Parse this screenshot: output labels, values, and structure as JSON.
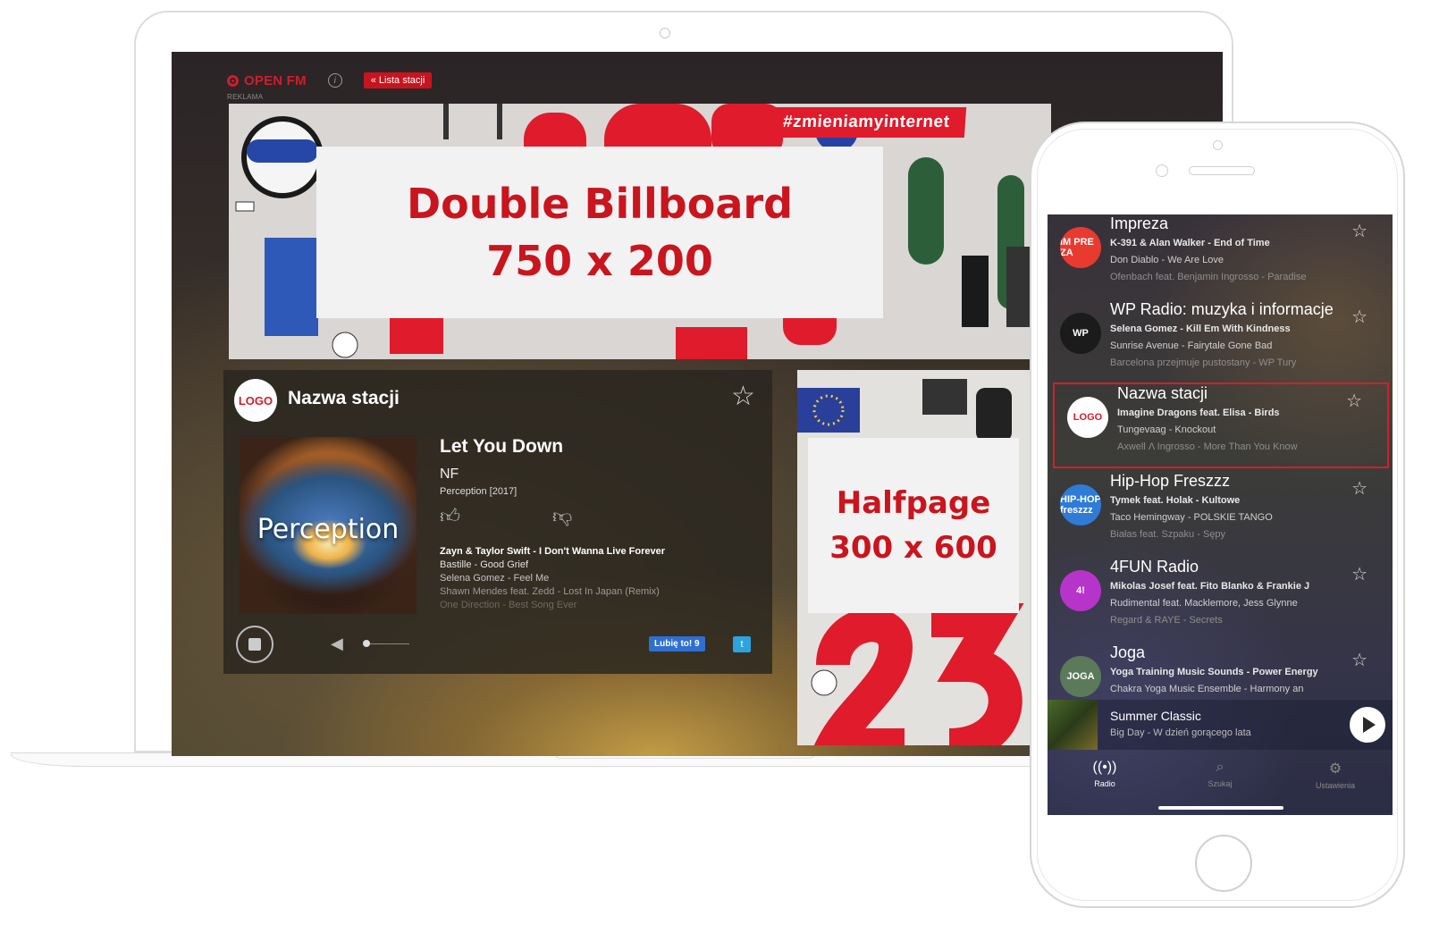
{
  "desktop": {
    "brand": "OPEN FM",
    "info_icon": "i",
    "list_button": "« Lista stacji",
    "ad_label": "REKLAMA",
    "billboard": {
      "hashtag": "#zmieniamyinternet",
      "line1": "Double Billboard",
      "line2": "750 x 200"
    },
    "player": {
      "logo": "LOGO",
      "station_name": "Nazwa stacji",
      "cover_text": "Perception",
      "song_title": "Let You Down",
      "artist": "NF",
      "album": "Perception [2017]",
      "history": [
        "Zayn & Taylor Swift - I Don't Wanna Live Forever",
        "Bastille - Good Grief",
        "Selena Gomez - Feel Me",
        "Shawn Mendes feat. Zedd - Lost In Japan (Remix)",
        "One Direction - Best Song Ever"
      ],
      "like_button": "Lubię to! 9",
      "twitter_icon": "t"
    },
    "halfpage": {
      "line1": "Halfpage",
      "line2": "300 x 600"
    }
  },
  "mobile": {
    "stations": [
      {
        "name": "Impreza",
        "logo": "IM PRE ZA",
        "logo_color": "#e83a2f",
        "tracks": [
          "K-391 & Alan Walker - End of Time",
          "Don Diablo - We Are Love",
          "Ofenbach feat. Benjamin Ingrosso - Paradise"
        ]
      },
      {
        "name": "WP Radio: muzyka i informacje",
        "logo": "WP",
        "logo_color": "#1b1b1b",
        "tracks": [
          "Selena Gomez - Kill Em With Kindness",
          "Sunrise Avenue - Fairytale Gone Bad",
          "Barcelona przejmuje pustostany - WP Tury"
        ]
      },
      {
        "name": "Nazwa stacji",
        "logo": "LOGO",
        "logo_color": "#ffffff",
        "tracks": [
          "Imagine Dragons feat. Elisa - Birds",
          "Tungevaag - Knockout",
          "Axwell Λ Ingrosso - More Than You Know"
        ]
      },
      {
        "name": "Hip-Hop Freszzz",
        "logo": "HIP-HOP freszzz",
        "logo_color": "#2f7bd6",
        "tracks": [
          "Tymek feat. Holak - Kultowe",
          "Taco Hemingway - POLSKIE TANGO",
          "Białas feat. Szpaku - Sępy"
        ]
      },
      {
        "name": "4FUN Radio",
        "logo": "4!",
        "logo_color": "#b634c9",
        "tracks": [
          "Mikolas Josef feat. Fito Blanko & Frankie J",
          "Rudimental feat. Macklemore, Jess Glynne",
          "Regard & RAYE - Secrets"
        ]
      },
      {
        "name": "Joga",
        "logo": "JOGA",
        "logo_color": "#5a7a5a",
        "tracks": [
          "Yoga Training Music Sounds - Power Energy",
          "Chakra Yoga Music Ensemble - Harmony an",
          ""
        ]
      }
    ],
    "now_playing": {
      "title": "Summer Classic",
      "subtitle": "Big Day - W dzień gorącego lata"
    },
    "tabs": [
      {
        "label": "Radio",
        "icon": "radio-icon"
      },
      {
        "label": "Szukaj",
        "icon": "search-icon"
      },
      {
        "label": "Ustawienia",
        "icon": "gear-icon"
      }
    ],
    "accent_color": "#d1202b"
  }
}
